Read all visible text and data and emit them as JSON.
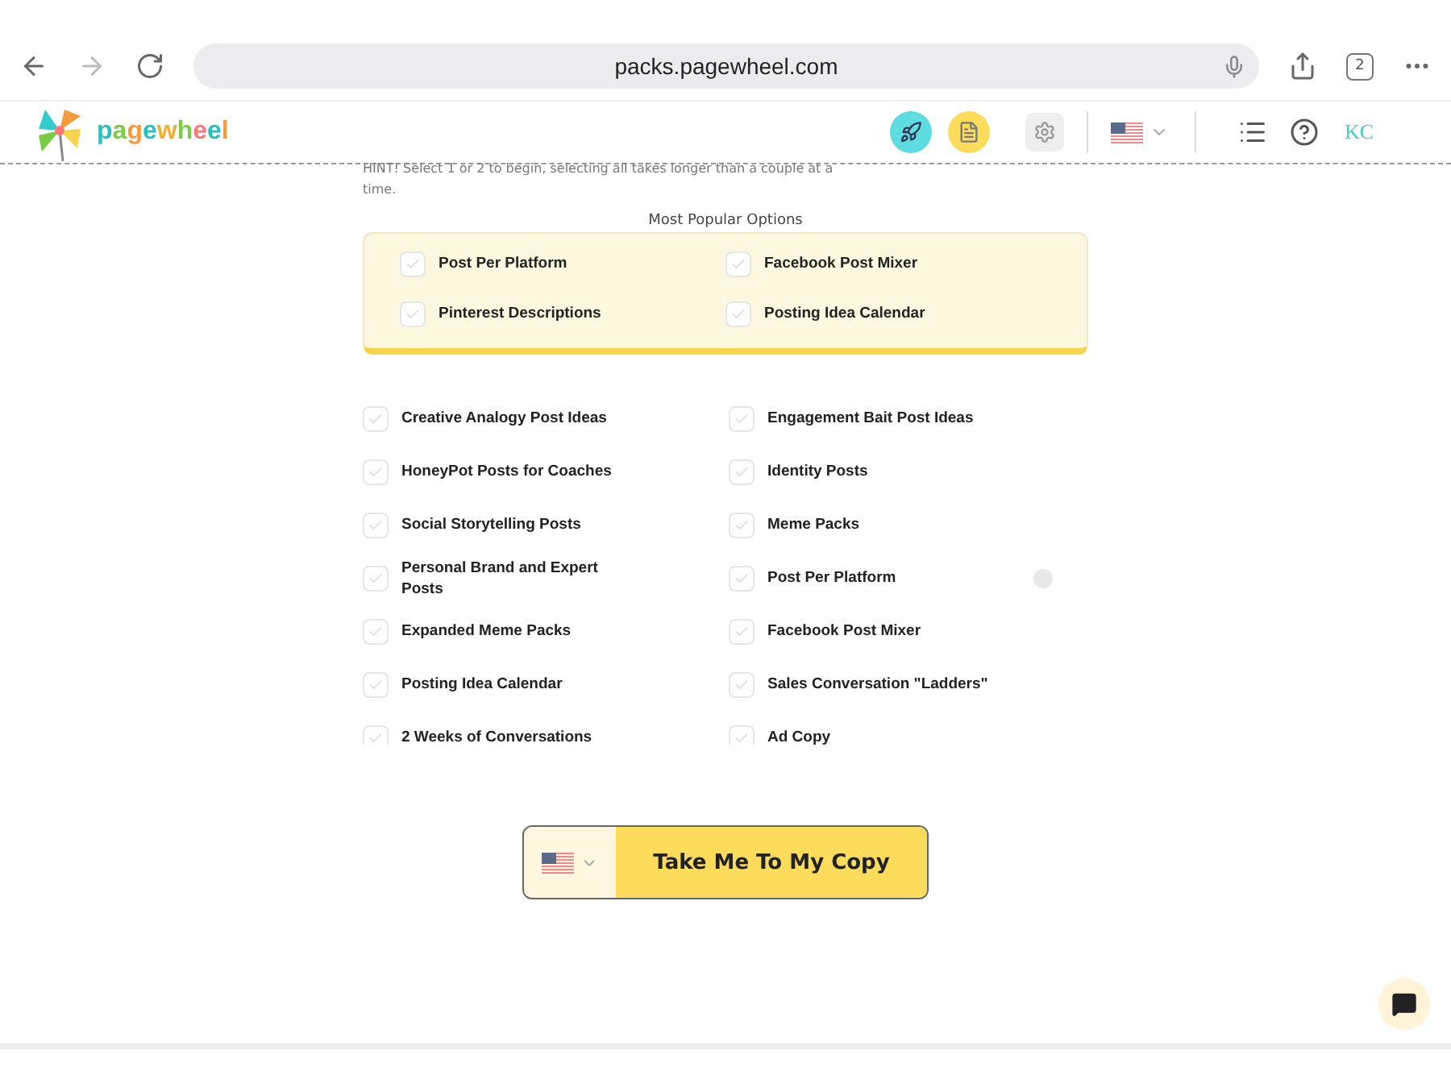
{
  "browser": {
    "url": "packs.pagewheel.com",
    "tab_count": "2"
  },
  "header": {
    "logo": "pagewheel",
    "avatar_text": "KC"
  },
  "hint": "HINT! Select 1 or 2 to begin, selecting all takes longer than a couple at a time.",
  "popular": {
    "title": "Most Popular Options",
    "options": [
      {
        "label": "Post Per Platform",
        "checked": false
      },
      {
        "label": "Facebook Post Mixer",
        "checked": false
      },
      {
        "label": "Pinterest Descriptions",
        "checked": false
      },
      {
        "label": "Posting Idea Calendar",
        "checked": false
      }
    ]
  },
  "options": [
    {
      "label": "Creative Analogy Post Ideas",
      "checked": false
    },
    {
      "label": "Engagement Bait Post Ideas",
      "checked": false
    },
    {
      "label": "HoneyPot Posts for Coaches",
      "checked": false
    },
    {
      "label": "Identity Posts",
      "checked": false
    },
    {
      "label": "Social Storytelling Posts",
      "checked": false
    },
    {
      "label": "Meme Packs",
      "checked": false
    },
    {
      "label": "Personal Brand and Expert Posts",
      "checked": false
    },
    {
      "label": "Post Per Platform",
      "checked": false,
      "info": true
    },
    {
      "label": "Expanded Meme Packs",
      "checked": false
    },
    {
      "label": "Facebook Post Mixer",
      "checked": false
    },
    {
      "label": "Posting Idea Calendar",
      "checked": false
    },
    {
      "label": "Sales Conversation \"Ladders\"",
      "checked": false
    },
    {
      "label": "2 Weeks of Conversations",
      "checked": false
    },
    {
      "label": "Ad Copy",
      "checked": false
    }
  ],
  "submit": {
    "label": "Take Me To My Copy"
  }
}
